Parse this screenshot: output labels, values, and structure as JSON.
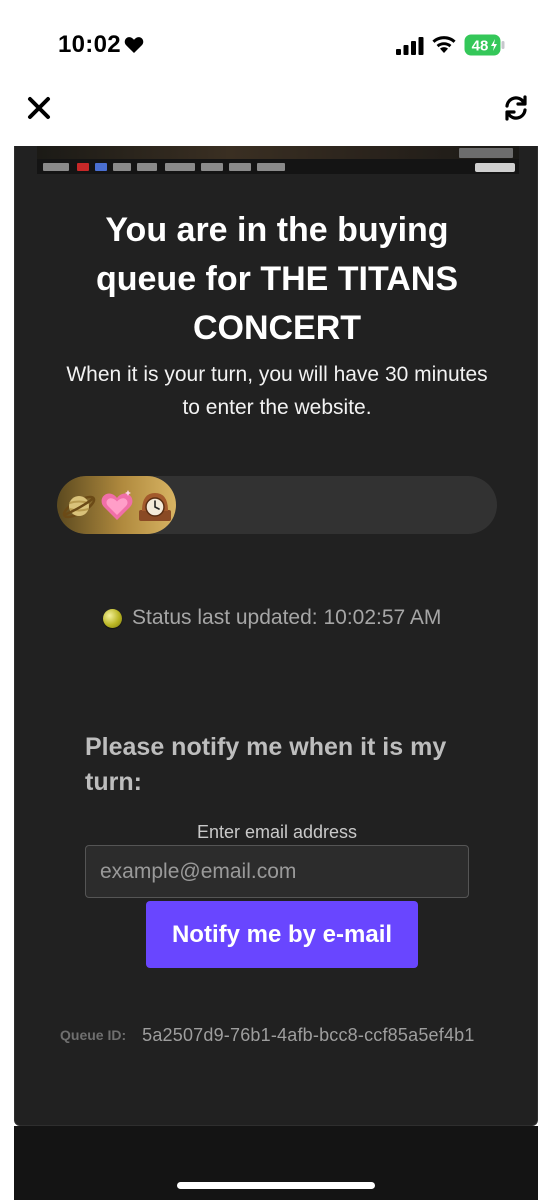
{
  "status_bar": {
    "time": "10:02",
    "battery_level": "48",
    "icons": [
      "heart-icon",
      "signal-icon",
      "wifi-icon",
      "battery-icon"
    ]
  },
  "browser_bar": {
    "close_icon": "close-icon",
    "reload_icon": "reload-icon"
  },
  "queue": {
    "title": "You are in the buying queue for THE TITANS CONCERT",
    "subtitle": "When it is your turn, you will have 30 minutes to enter the website.",
    "progress_fraction": 0.27,
    "progress_emojis": [
      "planet-emoji",
      "heart-emoji",
      "clock-emoji"
    ],
    "status_text": "Status last updated: 10:02:57 AM",
    "notify_heading": "Please notify me when it is my turn:",
    "email_label": "Enter email address",
    "email_placeholder": "example@email.com",
    "notify_button": "Notify me by e-mail",
    "queue_id_label": "Queue ID:",
    "queue_id_value": "5a2507d9-76b1-4afb-bcc8-ccf85a5ef4b1"
  },
  "colors": {
    "card_background": "#212121",
    "button_accent": "#6946ff",
    "progress_fill": "#b08a3e",
    "status_dot": "#b9b523",
    "battery_green": "#34c759"
  }
}
